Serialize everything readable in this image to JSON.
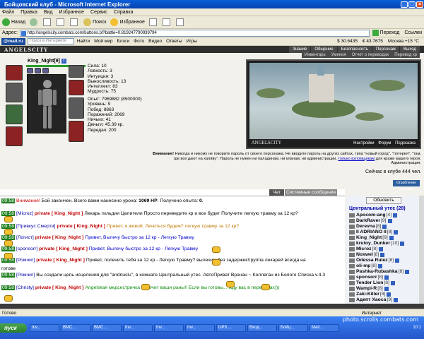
{
  "window": {
    "title": "Бойцовский клуб - Microsoft Internet Explorer"
  },
  "menu": [
    "Файл",
    "Правка",
    "Вид",
    "Избранное",
    "Сервис",
    "Справка"
  ],
  "toolbar": {
    "back": "Назад",
    "search": "Поиск",
    "favorites": "Избранное"
  },
  "address": {
    "label": "Адрес:",
    "url": "http://angelscity.combats.com/buttons.pl?battle=0.819247790939794",
    "go": "Переход",
    "links": "Ссылки"
  },
  "linksbar": {
    "brand": "@mail.ru",
    "search_placeholder": "Поиск в Интернете",
    "find": "Найти",
    "items": [
      "Мой мир",
      "Блоги",
      "Фото",
      "Видео",
      "Ответы",
      "Игры"
    ],
    "rates": [
      "$ 30.6435",
      "€ 43.7675",
      "Москва +15 °С"
    ]
  },
  "game": {
    "logo": "ANGELSCITY",
    "nav": [
      "Знание",
      "Общение",
      "Безопасность",
      "Персонаж",
      "Выход"
    ],
    "subnav": [
      "Инвентарь",
      "Умения",
      "Отчет о переводах",
      "Перевод кр"
    ],
    "character": {
      "name": "King_Night",
      "level": "[9]"
    },
    "stats": {
      "strength": "Сила: 10",
      "agility": "Ловкость: 3",
      "intuition": "Интуиция: 3",
      "endurance": "Выносливость: 13",
      "intellect": "Интеллект: 83",
      "wisdom": "Мудрость: 75"
    },
    "exp_label": "Опыт:",
    "exp_value": "7969882",
    "exp_next": "(8500000)",
    "level_line": "Уровень: 9",
    "wins": "Побед: 8863",
    "losses": "Поражений: 2069",
    "draws": "Ничьих: 41",
    "money_label": "Деньги:",
    "money_value": "45.39",
    "money_unit": "кр.",
    "transfers": "Передач: 200",
    "scene": {
      "logo": "ANGELSCITY",
      "links": [
        "Настройки",
        "Форум",
        "Подсказка"
      ]
    },
    "warning": {
      "bold": "Внимание!",
      "text": "Никогда и никому не говорите пароль от своего персонажа. Не вводите пароль на других сайтах, типа \"новый город\", \"лотерея\", \"там, где все дают на халяву\". Пароль не нужен ни паладинам, ни кланам, ни администрации,",
      "link": "только взломщикам",
      "tail": "для кражи вашего героя.",
      "sign": "Администрация."
    },
    "online": "Сейчас в клубе 444 чел.",
    "counter": "Ограбление прерван",
    "tabs": {
      "chat": "Чат",
      "system": "Системные сообщения"
    }
  },
  "chat": [
    {
      "time": "09:58",
      "parts": [
        {
          "c": "wn",
          "t": "Внимание!"
        },
        {
          "c": "",
          "t": " Бой закончен. Всего вами нанесено урона: "
        },
        {
          "c": "b",
          "t": "1069 HP"
        },
        {
          "c": "",
          "t": ". Получено опыта: "
        },
        {
          "c": "b",
          "t": "0"
        },
        {
          "c": "",
          "t": "."
        }
      ]
    },
    {
      "time": "09:58",
      "parts": [
        {
          "c": "chn",
          "t": "[Microz]"
        },
        {
          "c": "prv",
          "t": " private [ King_Night ] "
        },
        {
          "c": "",
          "t": "Лекарь гильдии Целители Просто переведите кр и все будет"
        },
        {
          "c": "",
          "t": " Получите легкую травму за 12 кр?"
        }
      ]
    },
    {
      "time": "09:58",
      "parts": [
        {
          "c": "chn",
          "t": "[Привкус Смерти]"
        },
        {
          "c": "prv",
          "t": " private [ King_Night ] "
        },
        {
          "c": "yl",
          "t": "Привет, я живой. Лечиться будем? легкую травму за 12 кр?"
        }
      ]
    },
    {
      "time": "09:58",
      "parts": [
        {
          "c": "chn",
          "t": "[Логист]"
        },
        {
          "c": "prv",
          "t": " private [ King_Night ] "
        },
        {
          "c": "ml",
          "t": "Привет, Вылечу быстро за 12 кр - Легкую Травму"
        }
      ]
    },
    {
      "time": "09:58",
      "parts": [
        {
          "c": "chn",
          "t": "[sponsorr]"
        },
        {
          "c": "prv",
          "t": " private [ King_Night ] "
        },
        {
          "c": "ml",
          "t": "Привет, Вылечу быстро за 12 кр - Легкую Травму"
        }
      ]
    },
    {
      "time": "09:58",
      "parts": [
        {
          "c": "chn",
          "t": "[Ромчиг]"
        },
        {
          "c": "prv",
          "t": " private [ King_Night ] "
        },
        {
          "c": "",
          "t": "Привет, полечить тебя за 12 кр - Легкую Травму?"
        },
        {
          "c": "",
          "t": "       вылечим без задержек!группа лекарей всегда на"
        }
      ]
    },
    {
      "time": "",
      "parts": [
        {
          "c": "",
          "t": "готове"
        }
      ]
    },
    {
      "time": "09:58",
      "parts": [
        {
          "c": "chn",
          "t": "[Ромчиг]"
        },
        {
          "c": "",
          "t": " Вы создали цепь исцеления для \"andriuslu\", в комнате Центральный утес. АвтоПриват Врачан ~ Коллеган из Белого Списка v.4.3"
        }
      ]
    },
    {
      "time": "09:58",
      "parts": [
        {
          "c": "chn",
          "t": "[Christy]"
        },
        {
          "c": "prv",
          "t": " private [ King_Night ] "
        },
        {
          "c": "",
          "t": "             "
        },
        {
          "c": "gr",
          "t": "Angelskaя медсестричка залечит ваши раны!!"
        },
        {
          "c": "",
          "t": "       "
        },
        {
          "c": "gr",
          "t": "Если вы готовы... жду вас в передачах)))"
        }
      ]
    }
  ],
  "userlist": {
    "refresh": "Обновить",
    "title": "Центральный утес (28)",
    "users": [
      {
        "name": "Apocom-ang",
        "lvl": "[4]"
      },
      {
        "name": "DarkRaver",
        "lvl": "[9]"
      },
      {
        "name": "Derevna",
        "lvl": "[8]"
      },
      {
        "name": "II ADRIANO II",
        "lvl": "[8]"
      },
      {
        "name": "King_Night",
        "lvl": "[9]"
      },
      {
        "name": "krutoy_Dunker",
        "lvl": "[10]"
      },
      {
        "name": "Microz",
        "lvl": "[8]"
      },
      {
        "name": "Noxwel",
        "lvl": "[8]"
      },
      {
        "name": "Odessa Rulez",
        "lvl": "[8]"
      },
      {
        "name": "oli-mp",
        "lvl": "[8]"
      },
      {
        "name": "Pashka-Rubashka",
        "lvl": "[8]"
      },
      {
        "name": "sponsorr",
        "lvl": "[8]"
      },
      {
        "name": "Tender Lion",
        "lvl": "[8]"
      },
      {
        "name": "Wampi-R",
        "lvl": "[8]"
      },
      {
        "name": "Zaki-Killer",
        "lvl": "[8]"
      },
      {
        "name": "Адепт Хаоса",
        "lvl": "[9]"
      }
    ]
  },
  "status": {
    "text": "Готово",
    "zone": "Интернет"
  },
  "taskbar": {
    "start": "пуск",
    "items": [
      "Inv...",
      "ВМС...",
      "ВМС...",
      "Inv...",
      "Inv...",
      "Inv...",
      "UPS ...",
      "Вход...",
      "Бойц...",
      "Mail..."
    ],
    "watermark": "photo.scrolls.combats.com",
    "clock": "10:1"
  }
}
